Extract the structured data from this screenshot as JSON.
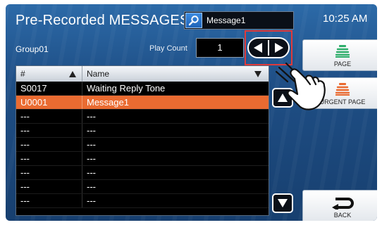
{
  "header": {
    "title": "Pre-Recorded MESSAGES",
    "search": {
      "value": "Message1"
    },
    "clock": "10:25 AM"
  },
  "info": {
    "group": "Group01",
    "play_count_label": "Play Count",
    "play_count_value": "1"
  },
  "table": {
    "columns": [
      "#",
      "Name"
    ],
    "rows": [
      {
        "num": "S0017",
        "name": "Waiting Reply Tone",
        "selected": false
      },
      {
        "num": "U0001",
        "name": "Message1",
        "selected": true
      },
      {
        "num": "---",
        "name": "---",
        "selected": false
      },
      {
        "num": "---",
        "name": "---",
        "selected": false
      },
      {
        "num": "---",
        "name": "---",
        "selected": false
      },
      {
        "num": "---",
        "name": "---",
        "selected": false
      },
      {
        "num": "---",
        "name": "---",
        "selected": false
      },
      {
        "num": "---",
        "name": "---",
        "selected": false
      },
      {
        "num": "---",
        "name": "---",
        "selected": false
      }
    ]
  },
  "side_buttons": {
    "page": "PAGE",
    "urgent_page": "URGENT PAGE",
    "back": "BACK"
  },
  "colors": {
    "selected_row": "#ea6b31",
    "page_icon": "#2fae6b",
    "urgent_icon": "#ea6b31",
    "highlight": "#e03a3a"
  }
}
